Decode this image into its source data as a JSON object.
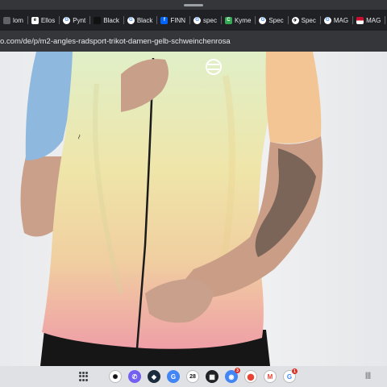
{
  "tabs": [
    {
      "label": "lom",
      "icon": "generic-tab-icon"
    },
    {
      "label": "Ellos",
      "icon": "ellos-icon"
    },
    {
      "label": "Pynt",
      "icon": "google-icon"
    },
    {
      "label": "Black",
      "icon": "black-icon"
    },
    {
      "label": "Black",
      "icon": "google-icon"
    },
    {
      "label": "FINN",
      "icon": "finn-icon"
    },
    {
      "label": "spec",
      "icon": "google-icon"
    },
    {
      "label": "Kyme",
      "icon": "kyme-icon"
    },
    {
      "label": "Spec",
      "icon": "google-icon"
    },
    {
      "label": "Spec",
      "icon": "spec-icon"
    },
    {
      "label": "MAG",
      "icon": "google-icon"
    },
    {
      "label": "MAG",
      "icon": "flag-icon"
    }
  ],
  "address": {
    "url": "o.com/de/p/m2-angles-radsport-trikot-damen-gelb-schweinchenrosa"
  },
  "shelf": {
    "calendar_day": "28",
    "badges": {
      "chrome": "3",
      "google": "1"
    },
    "right_glyph": "|||"
  },
  "colors": {
    "jersey_top": "#e3f0c6",
    "jersey_mid": "#efe3a6",
    "jersey_bottom": "#efa3a8",
    "sleeve_blue": "#8fb8df",
    "sleeve_peach": "#f2c08f"
  }
}
